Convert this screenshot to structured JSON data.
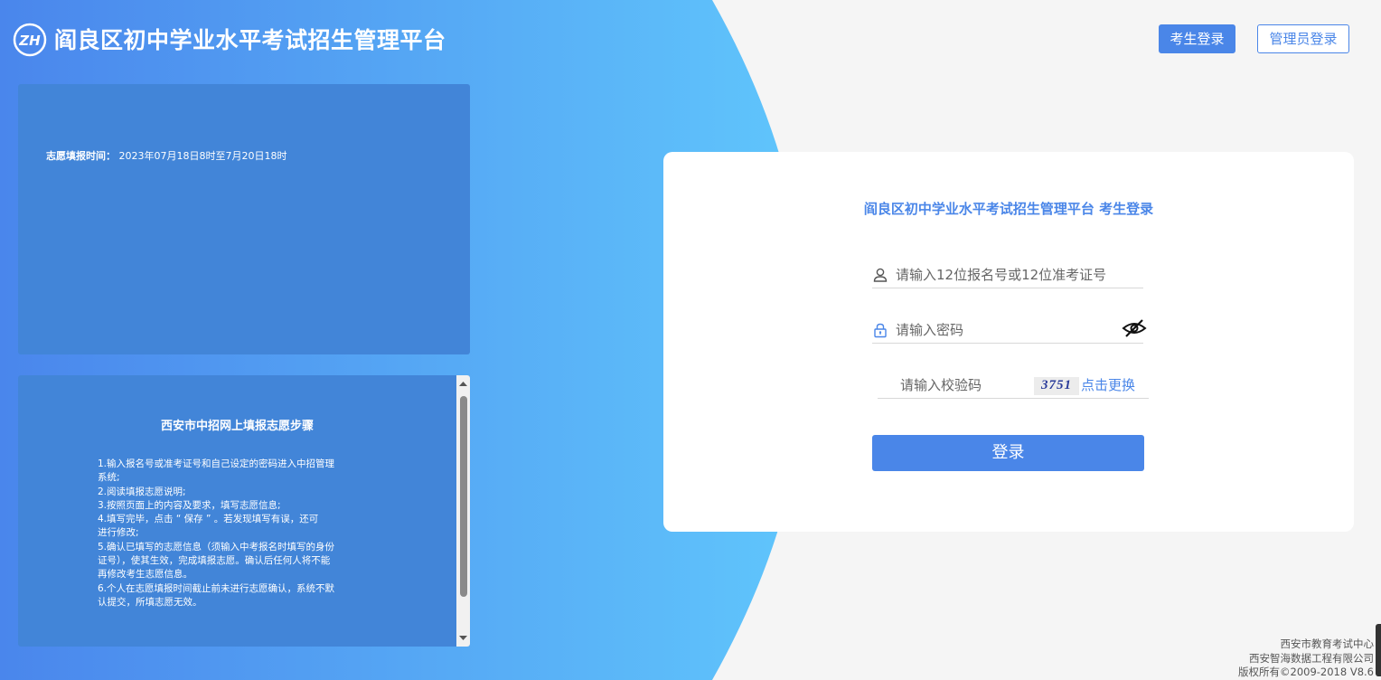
{
  "header": {
    "logo_text": "ZH",
    "title": "阎良区初中学业水平考试招生管理平台",
    "student_login_label": "考生登录",
    "admin_login_label": "管理员登录"
  },
  "notice": {
    "time_label": "志愿填报时间：",
    "time_value": "2023年07月18日8时至7月20日18时"
  },
  "steps": {
    "title": "西安市中招网上填报志愿步骤",
    "lines": [
      "1.输入报名号或准考证号和自己设定的密码进入中招管理",
      "系统;",
      "2.阅读填报志愿说明;",
      "3.按照页面上的内容及要求，填写志愿信息;",
      "4.填写完毕，点击 “ 保存 ” 。若发现填写有误，还可",
      "进行修改;",
      "5.确认已填写的志愿信息（须输入中考报名时填写的身份",
      "证号），使其生效，完成填报志愿。确认后任何人将不能",
      "再修改考生志愿信息。",
      " 6.个人在志愿填报时间截止前未进行志愿确认，系统不默",
      "认提交，所填志愿无效。"
    ]
  },
  "login": {
    "title": "阎良区初中学业水平考试招生管理平台 考生登录",
    "username_placeholder": "请输入12位报名号或12位准考证号",
    "password_placeholder": "请输入密码",
    "captcha_placeholder": "请输入校验码",
    "captcha_value": "3751",
    "captcha_refresh_label": "点击更换",
    "submit_label": "登录"
  },
  "footer": {
    "line1": "西安市教育考试中心",
    "line2": "西安智海数据工程有限公司",
    "line3": "版权所有©2009-2018 V8.6"
  },
  "colors": {
    "primary": "#4a86e8",
    "gradient_start": "#4a86e8",
    "gradient_end": "#60c4fc",
    "panel": "#4285d8",
    "page_bg": "#f5f5f5"
  }
}
